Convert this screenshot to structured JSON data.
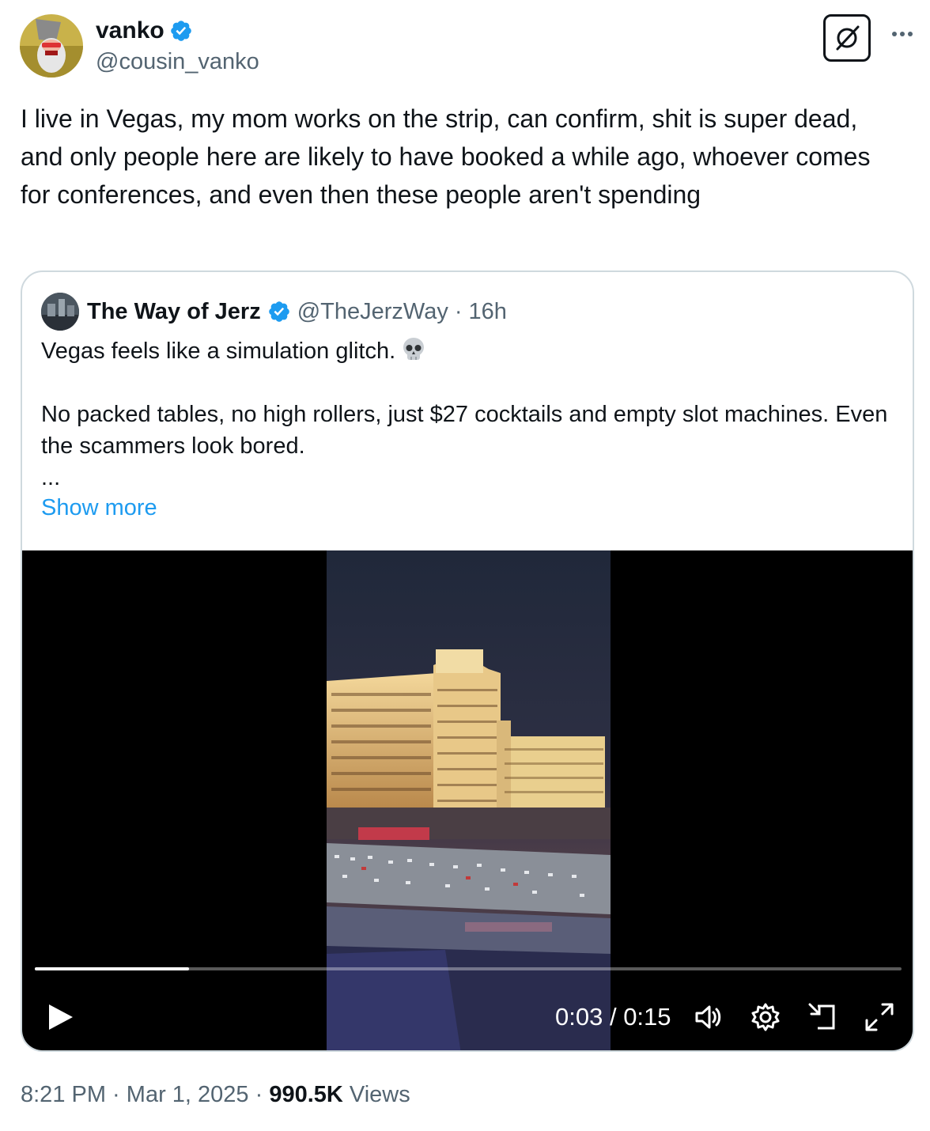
{
  "author": {
    "name": "vanko",
    "handle": "@cousin_vanko",
    "verified": true,
    "avatar_icon": "wizard-avatar-icon"
  },
  "actions": {
    "grok_icon": "grok-icon",
    "more_icon": "more-dots-icon"
  },
  "tweet": {
    "text": "I live in Vegas, my mom works on the strip, can confirm, shit is super dead, and only people here are likely to have booked a while ago, whoever comes for conferences, and even then these people aren't spending"
  },
  "quote": {
    "name": "The Way of Jerz",
    "handle": "@TheJerzWay",
    "separator": "·",
    "time": "16h",
    "line1": "Vegas feels like a simulation glitch.",
    "line1_emoji": "skull-icon",
    "line2": "No packed tables, no high rollers, just $27 cocktails and empty slot machines. Even the scammers look bored.",
    "ellipsis": "...",
    "show_more": "Show more"
  },
  "video": {
    "current": "0:03",
    "separator": " / ",
    "duration": "0:15",
    "progress": 0.178
  },
  "meta": {
    "time": "8:21 PM",
    "sep1": " · ",
    "date": "Mar 1, 2025",
    "sep2": " · ",
    "views": "990.5K",
    "views_label": " Views"
  },
  "colors": {
    "accent": "#1d9bf0",
    "secondary_text": "#536471",
    "border": "#cfd9de"
  }
}
